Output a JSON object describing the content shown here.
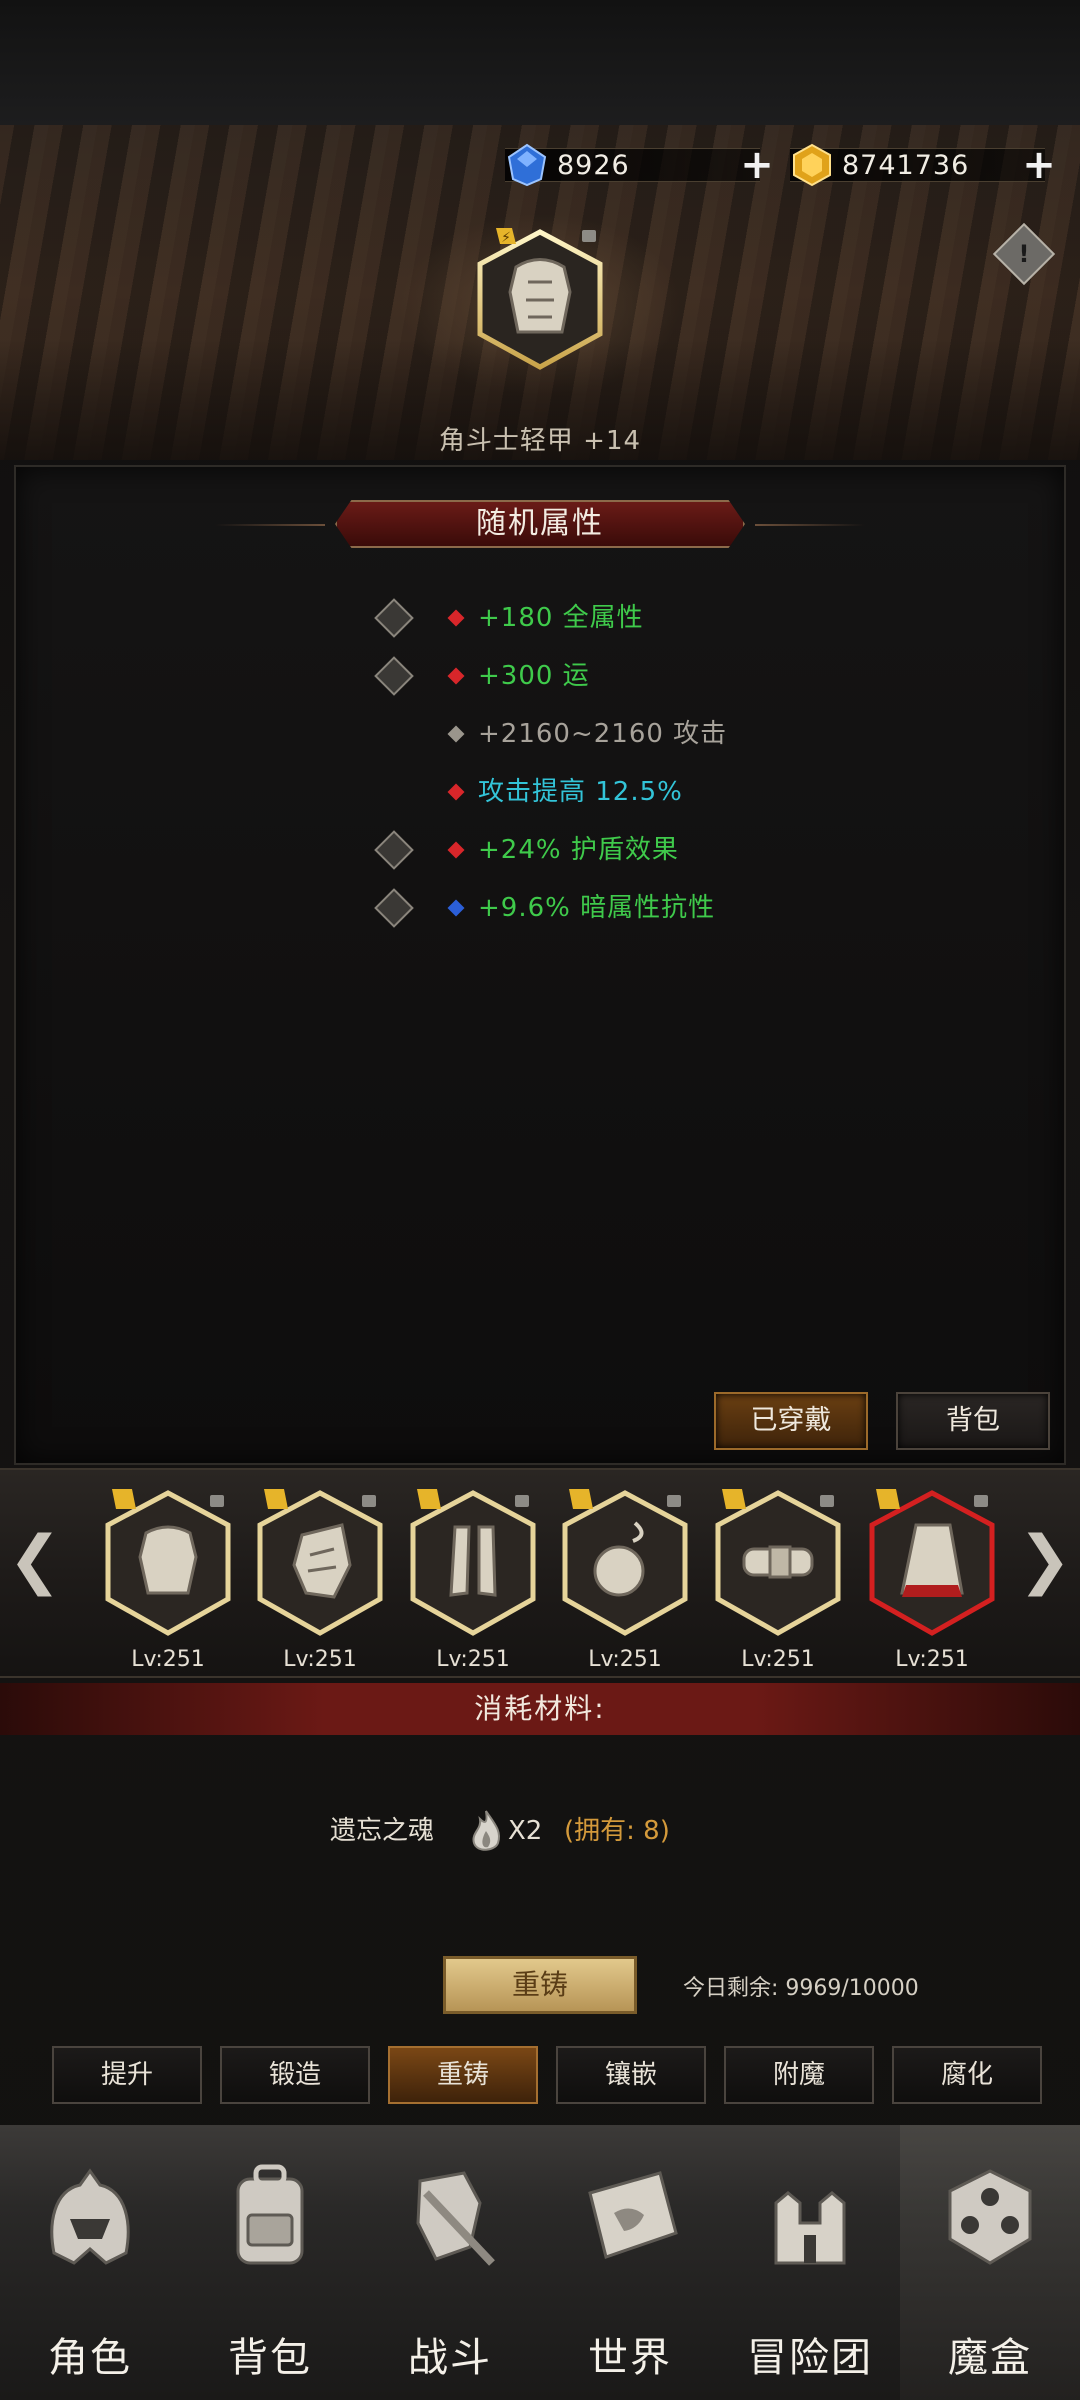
{
  "currencies": [
    {
      "name": "diamond",
      "value": "8926",
      "color": "#3a7de0"
    },
    {
      "name": "gold",
      "value": "8741736",
      "color": "#e0a21a"
    }
  ],
  "header": {
    "item_name": "角斗士轻甲 +14",
    "info_icon": "!"
  },
  "attributes": {
    "title": "随机属性",
    "rows": [
      {
        "text": "+180 全属性",
        "color": "#3fca4b",
        "gem": "#d8262a",
        "locked": true
      },
      {
        "text": "+300 运",
        "color": "#3fca4b",
        "gem": "#d8262a",
        "locked": true
      },
      {
        "text": "+2160~2160 攻击",
        "color": "#a7a29a",
        "gem": "#9a958c",
        "locked": false
      },
      {
        "text": "攻击提高 12.5%",
        "color": "#33c4d8",
        "gem": "#d8262a",
        "locked": false
      },
      {
        "text": "+24% 护盾效果",
        "color": "#3fca4b",
        "gem": "#d8262a",
        "locked": true
      },
      {
        "text": "+9.6% 暗属性抗性",
        "color": "#3fca4b",
        "gem": "#2b5fd8",
        "locked": true
      }
    ]
  },
  "panel_buttons": {
    "equipped": "已穿戴",
    "bag": "背包"
  },
  "carousel": {
    "left_arrow": "❮",
    "right_arrow": "❯",
    "slots": [
      {
        "icon": "armor-icon",
        "level": "Lv:251",
        "selected": false
      },
      {
        "icon": "gauntlet-icon",
        "level": "Lv:251",
        "selected": false
      },
      {
        "icon": "greaves-icon",
        "level": "Lv:251",
        "selected": false
      },
      {
        "icon": "amulet-icon",
        "level": "Lv:251",
        "selected": false
      },
      {
        "icon": "belt-icon",
        "level": "Lv:251",
        "selected": false
      },
      {
        "icon": "cloak-icon",
        "level": "Lv:251",
        "selected": true
      }
    ]
  },
  "materials": {
    "header": "消耗材料:",
    "name": "遗忘之魂",
    "qty": "X2",
    "owned": "(拥有: 8)"
  },
  "reforge": {
    "button": "重铸",
    "remaining": "今日剩余: 9969/10000"
  },
  "tabs": [
    {
      "label": "提升",
      "active": false
    },
    {
      "label": "锻造",
      "active": false
    },
    {
      "label": "重铸",
      "active": true
    },
    {
      "label": "镶嵌",
      "active": false
    },
    {
      "label": "附魔",
      "active": false
    },
    {
      "label": "腐化",
      "active": false
    }
  ],
  "nav": [
    {
      "label": "角色",
      "icon": "helmet-icon"
    },
    {
      "label": "背包",
      "icon": "backpack-icon"
    },
    {
      "label": "战斗",
      "icon": "shield-sword-icon"
    },
    {
      "label": "世界",
      "icon": "map-scroll-icon"
    },
    {
      "label": "冒险团",
      "icon": "castle-icon"
    },
    {
      "label": "魔盒",
      "icon": "magic-box-icon",
      "active": true
    }
  ]
}
